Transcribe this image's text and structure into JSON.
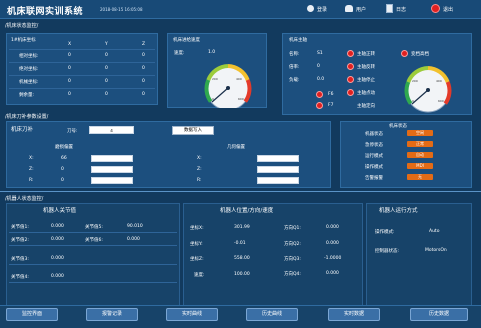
{
  "header": {
    "title": "机床联网实训系统",
    "datetime": "2018-08-15 16:05:08",
    "nav": [
      {
        "label": "登录",
        "icon": "login-icon"
      },
      {
        "label": "用户",
        "icon": "user-icon"
      },
      {
        "label": "日志",
        "icon": "log-icon"
      },
      {
        "label": "退出",
        "icon": "exit-icon"
      }
    ]
  },
  "machine_status": {
    "section_title": "/机床状态监控/",
    "coords": {
      "title": "1#机床坐标",
      "axes": [
        "X",
        "Y",
        "Z"
      ],
      "rows": [
        {
          "label": "相对坐标:",
          "values": [
            "0",
            "0",
            "0"
          ]
        },
        {
          "label": "绝对坐标:",
          "values": [
            "0",
            "0",
            "0"
          ]
        },
        {
          "label": "机械坐标:",
          "values": [
            "0",
            "0",
            "0"
          ]
        },
        {
          "label": "剩余量:",
          "values": [
            "0",
            "0",
            "0"
          ]
        }
      ]
    },
    "feed": {
      "title": "机床进给速度",
      "speed_label": "速度:",
      "speed_value": "1.0",
      "gauge_value": 1,
      "gauge_max": 600,
      "gauge_ticks": [
        "0",
        "200",
        "400",
        "600"
      ]
    },
    "spindle": {
      "title": "机床主轴",
      "rows": [
        {
          "label": "名称:",
          "value": "S1"
        },
        {
          "label": "倍率:",
          "value": "0"
        },
        {
          "label": "负载:",
          "value": "0.0"
        }
      ],
      "f_labels": [
        "F6",
        "F7"
      ],
      "indicators": [
        "主轴正转",
        "主轴反转",
        "主轴停止",
        "主轴点动",
        "主轴定向"
      ],
      "alarm_label": "变档高档",
      "gauge_value": 0,
      "gauge_ticks": [
        "0",
        "200",
        "400",
        "600"
      ]
    }
  },
  "tool_params": {
    "section_title": "/机床刀补参数设置/",
    "title": "机床刀补",
    "tool_label": "刀号:",
    "tool_value": "4",
    "write_button": "数据写入",
    "wear_title": "磨损偏置",
    "geo_title": "几何偏置",
    "wear": [
      {
        "axis": "X:",
        "value": "66"
      },
      {
        "axis": "Z:",
        "value": "0"
      },
      {
        "axis": "R:",
        "value": "0"
      }
    ],
    "geo": [
      {
        "axis": "X:",
        "value": ""
      },
      {
        "axis": "Z:",
        "value": ""
      },
      {
        "axis": "R:",
        "value": ""
      }
    ]
  },
  "machine_state": {
    "title": "机床状态",
    "rows": [
      {
        "label": "机器状态",
        "value": "空闲"
      },
      {
        "label": "急停状态",
        "value": "正常"
      },
      {
        "label": "运行模式",
        "value": "自动"
      },
      {
        "label": "操作模式",
        "value": "MDI"
      },
      {
        "label": "告警报警",
        "value": "无"
      }
    ]
  },
  "robot": {
    "section_title": "/机器人状态监控/",
    "joints": {
      "title": "机器人关节值",
      "items": [
        {
          "label": "关节值1:",
          "value": "0.000"
        },
        {
          "label": "关节值5:",
          "value": "90.010"
        },
        {
          "label": "关节值2:",
          "value": "0.000"
        },
        {
          "label": "关节值6:",
          "value": "0.000"
        },
        {
          "label": "关节值3:",
          "value": "0.000"
        },
        {
          "label": "关节值4:",
          "value": "0.000"
        }
      ]
    },
    "position": {
      "title": "机器人位置/方向/速度",
      "coords": [
        {
          "label": "坐标X:",
          "value": "301.99"
        },
        {
          "label": "坐标Y:",
          "value": "-0.01"
        },
        {
          "label": "坐标Z:",
          "value": "558.00"
        }
      ],
      "directions": [
        {
          "label": "方向Q1:",
          "value": "0.000"
        },
        {
          "label": "方向Q2:",
          "value": "0.000"
        },
        {
          "label": "方向Q3:",
          "value": "-1.0000"
        },
        {
          "label": "方向Q4:",
          "value": "0.000"
        }
      ],
      "speed_label": "速度:",
      "speed_value": "100.00"
    },
    "run_mode": {
      "title": "机器人运行方式",
      "op_label": "操作模式:",
      "op_value": "Auto",
      "ctrl_label": "控制器状态:",
      "ctrl_value": "MotorsOn"
    }
  },
  "bottom_nav": [
    "监控界面",
    "报警记录",
    "实时曲线",
    "历史曲线",
    "实时数据",
    "历史数据"
  ],
  "colors": {
    "background": "#123a5e",
    "panel": "#1c4f7e",
    "accent_orange": "#e36b16",
    "indicator_red": "#e02020"
  }
}
